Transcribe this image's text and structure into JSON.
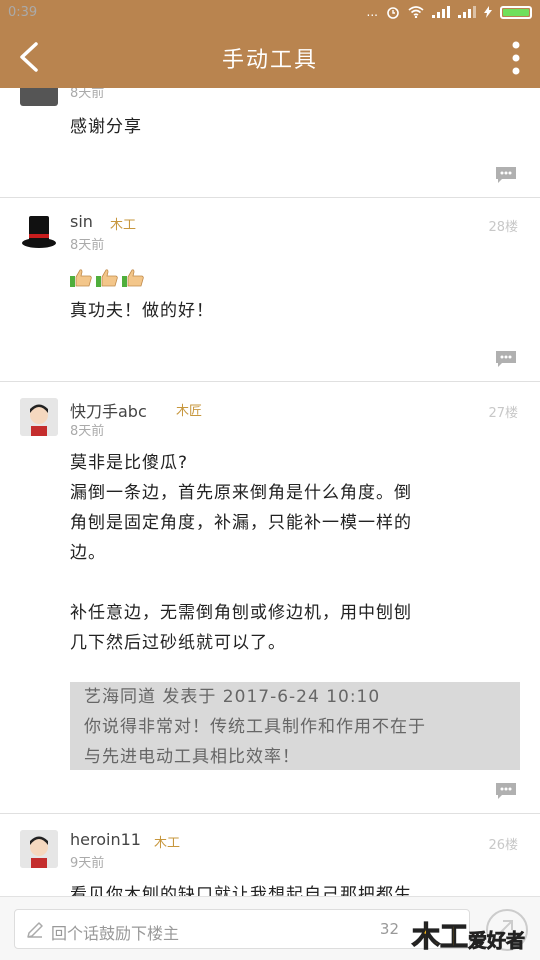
{
  "status": {
    "time": "0:39",
    "dots": "..."
  },
  "header": {
    "title": "手动工具"
  },
  "posts": [
    {
      "time": "8天前",
      "content": "感谢分享"
    },
    {
      "user": "sin",
      "rank": "木工",
      "time": "8天前",
      "floor": "28楼",
      "content": "真功夫！做的好！"
    },
    {
      "user": "快刀手abc",
      "rank": "木匠",
      "time": "8天前",
      "floor": "27楼",
      "lines": [
        "莫非是比傻瓜?",
        "漏倒一条边，首先原来倒角是什么角度。倒",
        "角刨是固定角度，补漏，只能补一模一样的",
        "边。",
        "补任意边，无需倒角刨或修边机，用中刨刨",
        "几下然后过砂纸就可以了。"
      ],
      "quote": {
        "header": "艺海同道 发表于 2017-6-24 10:10",
        "line1": "你说得非常对！传统工具制作和作用不在于",
        "line2": "与先进电动工具相比效率！"
      }
    },
    {
      "user": "heroin11",
      "rank": "木工",
      "time": "9天前",
      "floor": "26楼",
      "content": "看见你木刨的缺口就让我想起自己那把都生"
    }
  ],
  "bottom": {
    "placeholder": "回个话鼓励下楼主",
    "count": "32",
    "watermark": "木工爱好者"
  },
  "colors": {
    "brand": "#b9844f",
    "rank": "#c7973e"
  }
}
